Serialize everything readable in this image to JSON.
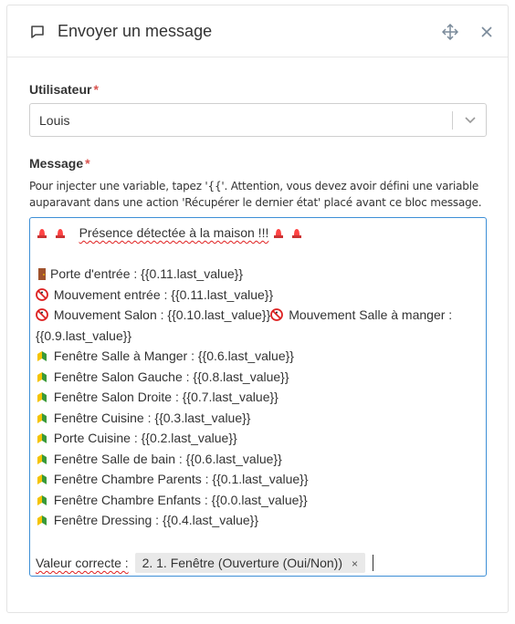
{
  "dialog": {
    "title": "Envoyer un message"
  },
  "user_field": {
    "label": "Utilisateur",
    "required_mark": "*",
    "value": "Louis"
  },
  "message_field": {
    "label": "Message",
    "required_mark": "*",
    "help": "Pour injecter une variable, tapez '{{'. Attention, vous devez avoir défini une variable auparavant dans une action 'Récupérer le dernier état' placé avant ce bloc message.",
    "lines": {
      "l0": "Présence détectée à la maison !!!",
      "l1": "Porte d'entrée :  {{0.11.last_value}}",
      "l2": "Mouvement entrée : {{0.11.last_value}}",
      "l3a": "Mouvement Salon : {{0.10.last_value}}",
      "l3b": "Mouvement Salle à manger : {{0.9.last_value}}",
      "l4": "Fenêtre Salle à Manger :  {{0.6.last_value}}",
      "l5": "Fenêtre Salon Gauche :  {{0.8.last_value}}",
      "l6": "Fenêtre Salon Droite :  {{0.7.last_value}}",
      "l7": "Fenêtre Cuisine : {{0.3.last_value}}",
      "l8": "Porte Cuisine : {{0.2.last_value}}",
      "l9": "Fenêtre Salle de bain : {{0.6.last_value}}",
      "l10": "Fenêtre Chambre Parents : {{0.1.last_value}}",
      "l11": "Fenêtre Chambre Enfants : {{0.0.last_value}}",
      "l12": "Fenêtre Dressing : {{0.4.last_value}}",
      "l13": "Valeur correcte :"
    },
    "tag": {
      "label": "2. 1. Fenêtre (Ouverture (Oui/Non))",
      "remove": "×"
    }
  },
  "icons": {
    "header": "chat-bubble-icon",
    "move": "move-arrows-icon",
    "close": "close-icon",
    "siren": "police-light-emoji",
    "door": "door-emoji",
    "no_pedestrian": "no-pedestrians-emoji",
    "beginner": "beginner-symbol-emoji"
  },
  "colors": {
    "accent_border": "#3d8fd6",
    "required": "#d9534f",
    "spellcheck": "#e02020"
  }
}
